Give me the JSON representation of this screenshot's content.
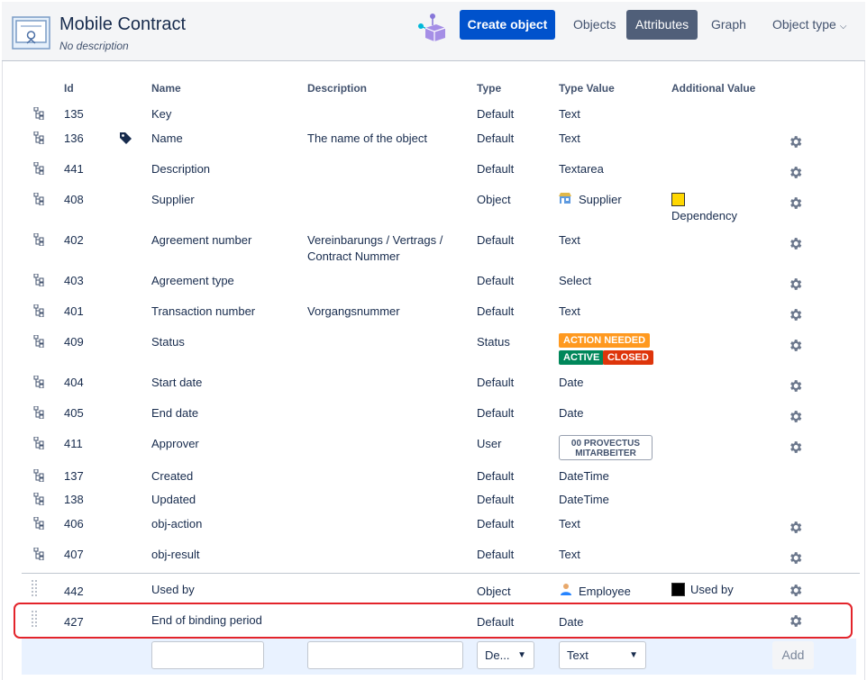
{
  "header": {
    "title": "Mobile Contract",
    "subtitle": "No description",
    "create_button": "Create object",
    "nav": {
      "objects": "Objects",
      "attributes": "Attributes",
      "graph": "Graph",
      "object_type": "Object type"
    }
  },
  "columns": {
    "id": "Id",
    "name": "Name",
    "description": "Description",
    "type": "Type",
    "type_value": "Type Value",
    "additional_value": "Additional Value"
  },
  "rows": [
    {
      "id": "135",
      "name": "Key",
      "description": "",
      "type": "Default",
      "type_value": "Text"
    },
    {
      "id": "136",
      "name": "Name",
      "description": "The name of the object",
      "type": "Default",
      "type_value": "Text"
    },
    {
      "id": "441",
      "name": "Description",
      "description": "",
      "type": "Default",
      "type_value": "Textarea"
    },
    {
      "id": "408",
      "name": "Supplier",
      "description": "",
      "type": "Object",
      "type_value": "Supplier",
      "additional": "Dependency",
      "additional_color": "#ffd700"
    },
    {
      "id": "402",
      "name": "Agreement number",
      "description_line1": "Vereinbarungs / Vertrags /",
      "description_line2": "Contract Nummer",
      "type": "Default",
      "type_value": "Text"
    },
    {
      "id": "403",
      "name": "Agreement type",
      "description": "",
      "type": "Default",
      "type_value": "Select"
    },
    {
      "id": "401",
      "name": "Transaction number",
      "description": "Vorgangsnummer",
      "type": "Default",
      "type_value": "Text"
    },
    {
      "id": "409",
      "name": "Status",
      "description": "",
      "type": "Status",
      "statuses": [
        {
          "label": "ACTION NEEDED",
          "color": "#ff991f"
        },
        {
          "label": "ACTIVE",
          "color": "#00875a"
        },
        {
          "label": "CLOSED",
          "color": "#de350b"
        }
      ]
    },
    {
      "id": "404",
      "name": "Start date",
      "description": "",
      "type": "Default",
      "type_value": "Date"
    },
    {
      "id": "405",
      "name": "End date",
      "description": "",
      "type": "Default",
      "type_value": "Date"
    },
    {
      "id": "411",
      "name": "Approver",
      "description": "",
      "type": "User",
      "user_line1": "00 PROVECTUS",
      "user_line2": "MITARBEITER"
    },
    {
      "id": "137",
      "name": "Created",
      "description": "",
      "type": "Default",
      "type_value": "DateTime"
    },
    {
      "id": "138",
      "name": "Updated",
      "description": "",
      "type": "Default",
      "type_value": "DateTime"
    },
    {
      "id": "406",
      "name": "obj-action",
      "description": "",
      "type": "Default",
      "type_value": "Text"
    },
    {
      "id": "407",
      "name": "obj-result",
      "description": "",
      "type": "Default",
      "type_value": "Text"
    },
    {
      "id": "442",
      "name": "Used by",
      "description": "",
      "type": "Object",
      "type_value": "Employee",
      "additional": "Used by",
      "additional_color": "#000000"
    },
    {
      "id": "427",
      "name": "End of binding period",
      "description": "",
      "type": "Default",
      "type_value": "Date"
    }
  ],
  "add_row": {
    "type_select": "De...",
    "type_value_select": "Text",
    "add_button": "Add"
  },
  "colors": {
    "accent": "#0052cc",
    "active_tab": "#505f79",
    "highlight": "#e3242b"
  }
}
